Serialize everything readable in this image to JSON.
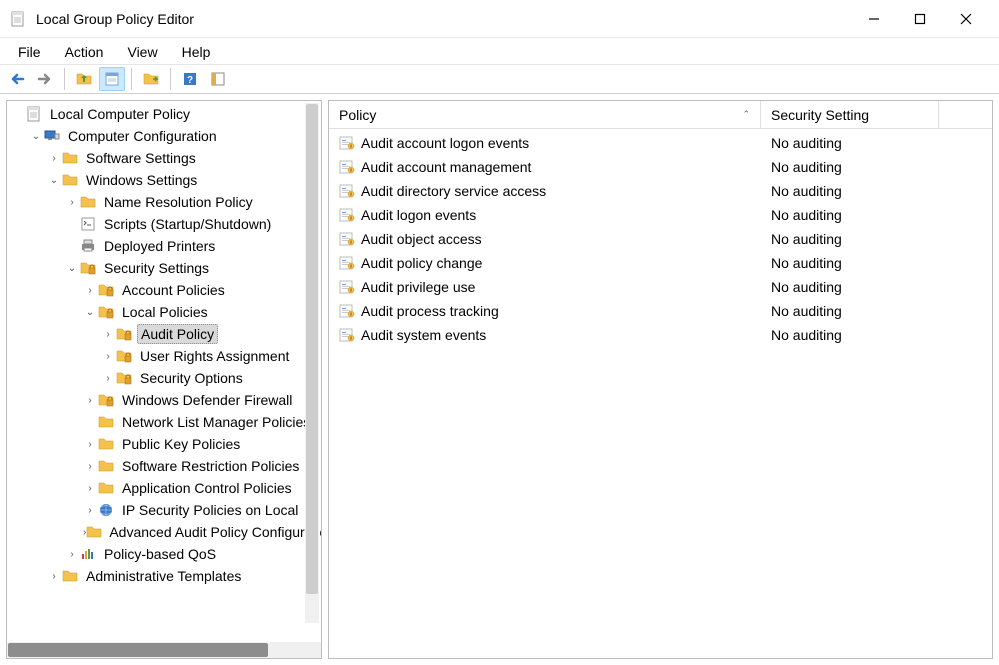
{
  "window": {
    "title": "Local Group Policy Editor"
  },
  "menubar": {
    "file": "File",
    "action": "Action",
    "view": "View",
    "help": "Help"
  },
  "toolbar": {
    "back": "back-icon",
    "forward": "forward-icon",
    "up": "up-icon",
    "props": "properties-icon",
    "refresh": "refresh-icon",
    "export": "export-icon",
    "help": "help-icon",
    "show": "show-icon"
  },
  "tree": {
    "root": "Local Computer Policy",
    "comp_config": "Computer Configuration",
    "software_settings": "Software Settings",
    "windows_settings": "Windows Settings",
    "name_resolution": "Name Resolution Policy",
    "scripts": "Scripts (Startup/Shutdown)",
    "deployed_printers": "Deployed Printers",
    "security_settings": "Security Settings",
    "account_policies": "Account Policies",
    "local_policies": "Local Policies",
    "audit_policy": "Audit Policy",
    "user_rights": "User Rights Assignment",
    "security_options": "Security Options",
    "defender_fw": "Windows Defender Firewall",
    "network_list": "Network List Manager Policies",
    "public_key": "Public Key Policies",
    "software_restriction": "Software Restriction Policies",
    "app_control": "Application Control Policies",
    "ip_security": "IP Security Policies on Local",
    "advanced_audit": "Advanced Audit Policy Configuration",
    "policy_qos": "Policy-based QoS",
    "admin_templates": "Administrative Templates"
  },
  "list": {
    "col_policy": "Policy",
    "col_setting": "Security Setting",
    "rows": [
      {
        "policy": "Audit account logon events",
        "setting": "No auditing"
      },
      {
        "policy": "Audit account management",
        "setting": "No auditing"
      },
      {
        "policy": "Audit directory service access",
        "setting": "No auditing"
      },
      {
        "policy": "Audit logon events",
        "setting": "No auditing"
      },
      {
        "policy": "Audit object access",
        "setting": "No auditing"
      },
      {
        "policy": "Audit policy change",
        "setting": "No auditing"
      },
      {
        "policy": "Audit privilege use",
        "setting": "No auditing"
      },
      {
        "policy": "Audit process tracking",
        "setting": "No auditing"
      },
      {
        "policy": "Audit system events",
        "setting": "No auditing"
      }
    ]
  }
}
